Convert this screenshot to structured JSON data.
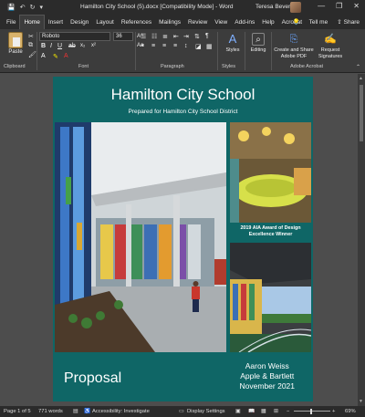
{
  "titlebar": {
    "doc_title": "Hamilton City School (5).docx [Compatibility Mode] - Word",
    "user_name": "Teresa Bever",
    "minimize": "—",
    "restore": "❐",
    "close": "✕"
  },
  "tabs": [
    {
      "label": "File"
    },
    {
      "label": "Home"
    },
    {
      "label": "Insert"
    },
    {
      "label": "Design"
    },
    {
      "label": "Layout"
    },
    {
      "label": "References"
    },
    {
      "label": "Mailings"
    },
    {
      "label": "Review"
    },
    {
      "label": "View"
    },
    {
      "label": "Add-ins"
    },
    {
      "label": "Help"
    },
    {
      "label": "Acrobat"
    }
  ],
  "tell_me": "Tell me",
  "share": "Share",
  "ribbon": {
    "paste_label": "Paste",
    "font_name": "Roboto",
    "font_size": "36",
    "group_clipboard": "Clipboard",
    "group_font": "Font",
    "group_paragraph": "Paragraph",
    "group_styles": "Styles",
    "group_acrobat": "Adobe Acrobat",
    "styles_label": "Styles",
    "editing_label": "Editing",
    "create_share_pdf": "Create and Share Adobe PDF",
    "request_signatures": "Request Signatures"
  },
  "page": {
    "title": "Hamilton City School",
    "subtitle": "Prepared for Hamilton City School District",
    "award": "2019 AIA Award of Design Excellence Winner",
    "proposal": "Proposal",
    "author_name": "Aaron Weiss",
    "company": "Apple & Bartlett",
    "date": "November 2021"
  },
  "statusbar": {
    "page": "Page 1 of 5",
    "words": "771 words",
    "accessibility": "Accessibility: Investigate",
    "display_settings": "Display Settings",
    "zoom": "69%"
  },
  "colors": {
    "accent": "#0f6666",
    "chrome": "#2b2b2b",
    "ribbon": "#3c3c3c"
  }
}
